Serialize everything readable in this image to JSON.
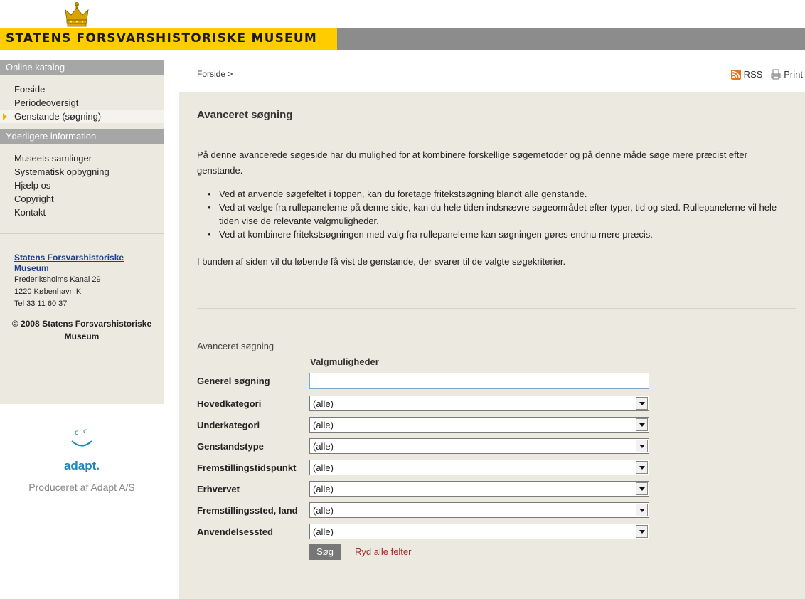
{
  "header": {
    "title": "STATENS FORSVARSHISTORISKE MUSEUM"
  },
  "sidebar": {
    "section1_title": "Online katalog",
    "section1_items": [
      "Forside",
      "Periodeoversigt",
      "Genstande (søgning)"
    ],
    "section2_title": "Yderligere information",
    "section2_items": [
      "Museets samlinger",
      "Systematisk opbygning",
      "Hjælp os",
      "Copyright",
      "Kontakt"
    ],
    "address": {
      "name": "Statens Forsvarshistoriske Museum",
      "street": "Frederiksholms Kanal 29",
      "city": "1220 København K",
      "phone": "Tel 33 11 60 37"
    },
    "copyright": "© 2008 Statens Forsvarshistoriske Museum",
    "producer_logo": "adapt.",
    "producer_text": "Produceret af Adapt A/S"
  },
  "breadcrumb": "Forside >",
  "toolbar": {
    "rss": "RSS -",
    "print": "Print"
  },
  "main": {
    "heading": "Avanceret søgning",
    "intro": "På denne avancerede søgeside har du mulighed for at kombinere forskellige søgemetoder og på denne måde søge mere præcist efter genstande.",
    "bullets": [
      "Ved at anvende søgefeltet i toppen, kan du foretage fritekstsøgning blandt alle genstande.",
      "Ved at vælge fra rullepanelerne på denne side, kan du hele tiden indsnævre søgeområdet efter typer, tid og sted. Rullepanelerne vil hele tiden vise de relevante valgmuligheder.",
      "Ved at kombinere fritekstsøgningen med valg fra rullepanelerne kan søgningen gøres endnu mere præcis."
    ],
    "bottom_note": "I bunden af siden vil du løbende få vist de genstande, der svarer til de valgte søgekriterier."
  },
  "form": {
    "title": "Avanceret søgning",
    "subtitle": "Valgmuligheder",
    "general_label": "Generel søgning",
    "general_value": "",
    "fields": [
      {
        "label": "Hovedkategori",
        "value": "(alle)"
      },
      {
        "label": "Underkategori",
        "value": "(alle)"
      },
      {
        "label": "Genstandstype",
        "value": "(alle)"
      },
      {
        "label": "Fremstillingstidspunkt",
        "value": "(alle)"
      },
      {
        "label": "Erhvervet",
        "value": "(alle)"
      },
      {
        "label": "Fremstillingssted, land",
        "value": "(alle)"
      },
      {
        "label": "Anvendelsessted",
        "value": "(alle)"
      }
    ],
    "search_button": "Søg",
    "clear_link": "Ryd alle felter"
  },
  "colors": {
    "banner_yellow": "#ffcc00",
    "banner_gray": "#8c8c8c",
    "panel_bg": "#ebe9e0",
    "rss_orange": "#e8731d",
    "adapt_blue": "#1c87b8"
  }
}
